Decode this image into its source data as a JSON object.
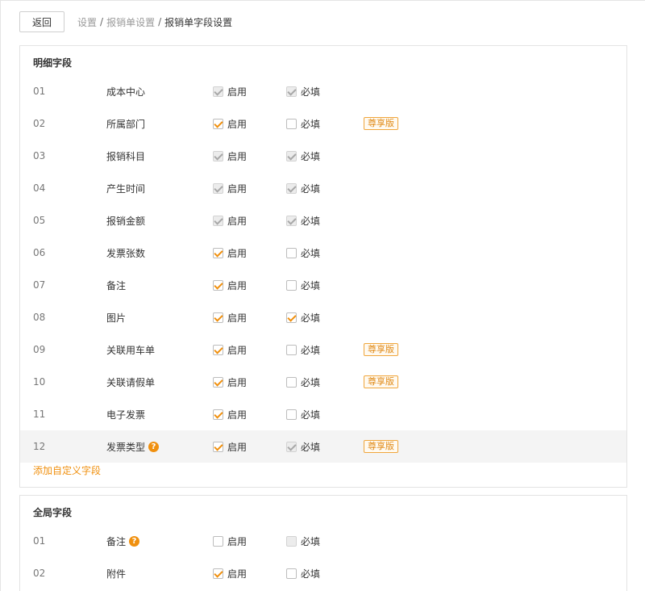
{
  "header": {
    "back_label": "返回",
    "breadcrumb": [
      "设置",
      "报销单设置",
      "报销单字段设置"
    ],
    "separator": "/"
  },
  "colors": {
    "accent": "#f0900f",
    "badge_border": "#f0a63c",
    "border": "#e3e3e3"
  },
  "labels": {
    "enable": "启用",
    "required": "必填",
    "premium": "尊享版"
  },
  "detail": {
    "title": "明细字段",
    "add_link": "添加自定义字段",
    "rows": [
      {
        "num": "01",
        "name": "成本中心",
        "enable": true,
        "enable_disabled": true,
        "req": true,
        "req_disabled": true,
        "premium": false,
        "help": false
      },
      {
        "num": "02",
        "name": "所属部门",
        "enable": true,
        "enable_disabled": false,
        "req": false,
        "req_disabled": false,
        "premium": true,
        "help": false
      },
      {
        "num": "03",
        "name": "报销科目",
        "enable": true,
        "enable_disabled": true,
        "req": true,
        "req_disabled": true,
        "premium": false,
        "help": false
      },
      {
        "num": "04",
        "name": "产生时间",
        "enable": true,
        "enable_disabled": true,
        "req": true,
        "req_disabled": true,
        "premium": false,
        "help": false
      },
      {
        "num": "05",
        "name": "报销金额",
        "enable": true,
        "enable_disabled": true,
        "req": true,
        "req_disabled": true,
        "premium": false,
        "help": false
      },
      {
        "num": "06",
        "name": "发票张数",
        "enable": true,
        "enable_disabled": false,
        "req": false,
        "req_disabled": false,
        "premium": false,
        "help": false
      },
      {
        "num": "07",
        "name": "备注",
        "enable": true,
        "enable_disabled": false,
        "req": false,
        "req_disabled": false,
        "premium": false,
        "help": false
      },
      {
        "num": "08",
        "name": "图片",
        "enable": true,
        "enable_disabled": false,
        "req": true,
        "req_disabled": false,
        "premium": false,
        "help": false
      },
      {
        "num": "09",
        "name": "关联用车单",
        "enable": true,
        "enable_disabled": false,
        "req": false,
        "req_disabled": false,
        "premium": true,
        "help": false
      },
      {
        "num": "10",
        "name": "关联请假单",
        "enable": true,
        "enable_disabled": false,
        "req": false,
        "req_disabled": false,
        "premium": true,
        "help": false
      },
      {
        "num": "11",
        "name": "电子发票",
        "enable": true,
        "enable_disabled": false,
        "req": false,
        "req_disabled": false,
        "premium": false,
        "help": false
      },
      {
        "num": "12",
        "name": "发票类型",
        "enable": true,
        "enable_disabled": false,
        "req": true,
        "req_disabled": true,
        "premium": true,
        "help": true,
        "highlight": true
      }
    ]
  },
  "global": {
    "title": "全局字段",
    "rows": [
      {
        "num": "01",
        "name": "备注",
        "enable": false,
        "enable_disabled": false,
        "req": false,
        "req_disabled": true,
        "premium": false,
        "help": true
      },
      {
        "num": "02",
        "name": "附件",
        "enable": true,
        "enable_disabled": false,
        "req": false,
        "req_disabled": false,
        "premium": false,
        "help": false
      }
    ]
  },
  "help_icon_glyph": "?"
}
